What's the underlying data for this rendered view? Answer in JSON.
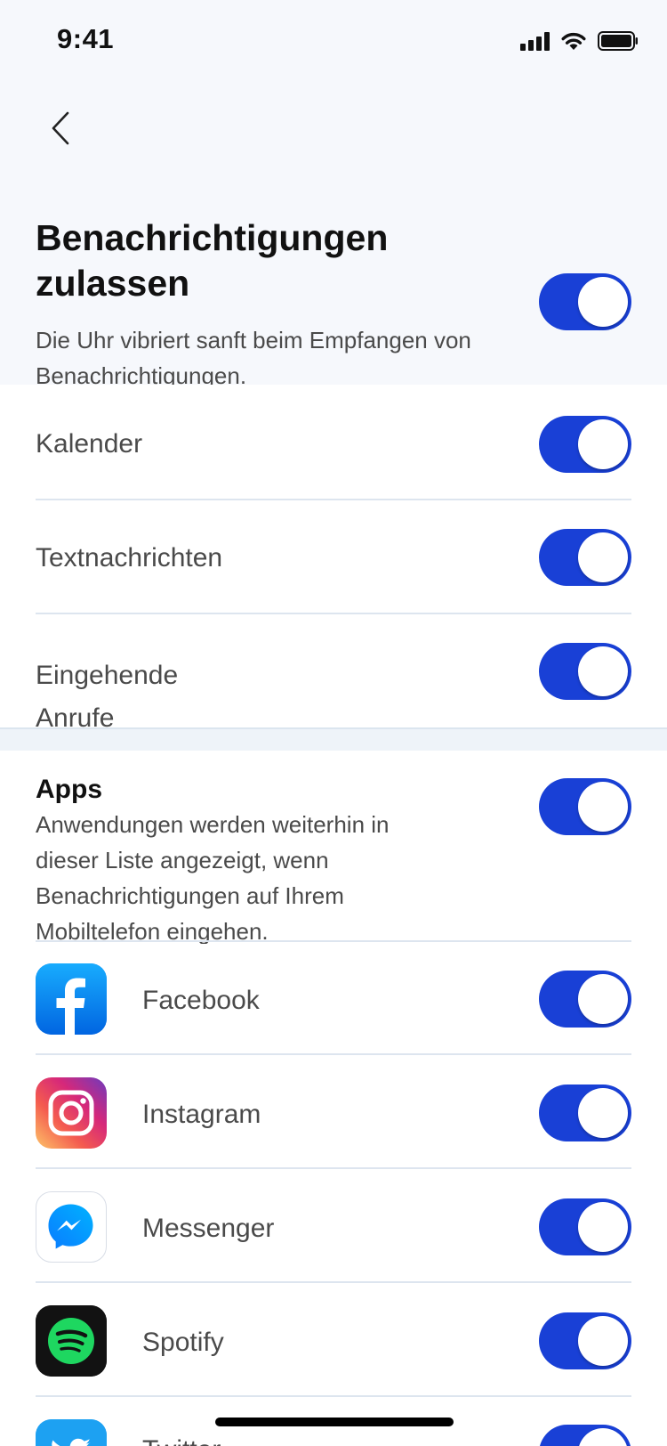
{
  "status_bar": {
    "time": "9:41"
  },
  "header": {
    "title": "Benachrichtigungen zulassen",
    "description": "Die Uhr vibriert sanft beim Empfangen von Benachrichtigungen.",
    "toggle_on": true
  },
  "categories": [
    {
      "label": "Kalender",
      "on": true
    },
    {
      "label": "Textnachrichten",
      "on": true
    },
    {
      "label": "Eingehende Anrufe",
      "on": true
    }
  ],
  "apps_section": {
    "title": "Apps",
    "description": "Anwendungen werden weiterhin in dieser Liste angezeigt, wenn Benachrichtigungen auf Ihrem Mobiltelefon eingehen.",
    "toggle_on": true
  },
  "apps": [
    {
      "label": "Facebook",
      "icon": "facebook-icon",
      "color": "#1877f2",
      "on": true
    },
    {
      "label": "Instagram",
      "icon": "instagram-icon",
      "color": "#e1306c",
      "on": true
    },
    {
      "label": "Messenger",
      "icon": "messenger-icon",
      "color": "#0a7cff",
      "on": true
    },
    {
      "label": "Spotify",
      "icon": "spotify-icon",
      "color": "#1ed760",
      "on": true
    },
    {
      "label": "Twitter",
      "icon": "twitter-icon",
      "color": "#1da1f2",
      "on": true
    }
  ],
  "colors": {
    "toggle_active": "#1940d6",
    "divider": "#dde5ef"
  }
}
